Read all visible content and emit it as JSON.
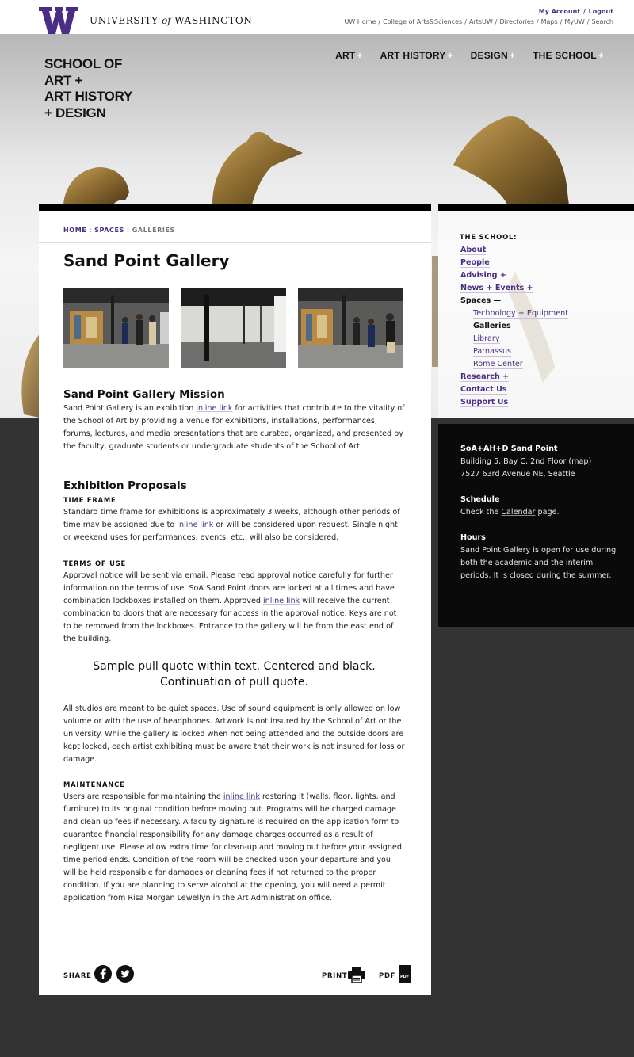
{
  "header": {
    "wordmark_left": "UNIVERSITY",
    "wordmark_of": "of",
    "wordmark_right": "WASHINGTON",
    "account": "My Account",
    "account_sep": "/",
    "logout": "Logout",
    "utility_links": [
      "UW Home",
      "College of Arts&Sciences",
      "ArtsUW",
      "Directories",
      "Maps",
      "MyUW",
      "Search"
    ]
  },
  "school_logo": [
    "SCHOOL OF",
    "ART +",
    "ART HISTORY",
    "+ DESIGN"
  ],
  "main_nav": [
    {
      "label": "ART",
      "icon": "plus-icon"
    },
    {
      "label": "ART HISTORY",
      "icon": "plus-icon"
    },
    {
      "label": "DESIGN",
      "icon": "plus-icon"
    },
    {
      "label": "THE SCHOOL",
      "icon": "plus-icon"
    }
  ],
  "breadcrumb": {
    "home": "HOME",
    "sep": ":",
    "spaces": "SPACES",
    "current": "GALLERIES"
  },
  "page": {
    "title": "Sand Point Gallery",
    "mission_heading": "Sand Point Gallery Mission",
    "mission_p": [
      "Sand Point Gallery is an exhibition ",
      "inline link",
      " for activities that contribute to the vitality of the School of Art by providing a venue for exhibitions, installations, performances, forums, lectures, and media presentations that are curated, organized, and presented by the faculty, graduate students or undergraduate students of the School of Art."
    ],
    "proposals_heading": "Exhibition Proposals",
    "time_frame_heading": "TIME FRAME",
    "time_frame_p": [
      "Standard time frame for exhibitions is approximately 3 weeks, although other periods of time may be assigned due to ",
      "inline link",
      " or will be considered upon request. Single night or weekend uses for performances, events, etc., will also be considered."
    ],
    "terms_heading": "TERMS OF USE",
    "terms_p": [
      "Approval notice will be sent via email. Please read approval notice carefully for further information on the terms of use. SoA Sand Point doors are locked at all times and have combination lockboxes installed on them. Approved ",
      "inline link",
      " will receive the current combination to doors that are necessary for access in the approval notice. Keys are not to be removed from the lockboxes. Entrance to the gallery will be from the east end of the building."
    ],
    "pull_quote": "Sample pull quote within text. Centered and black. Continuation of pull quote.",
    "studios_p": "All studios are meant to be quiet spaces. Use of sound equipment is only allowed on low volume or with the use of headphones. Artwork is not insured by the School of Art or the university. While the gallery is locked when not being attended and the outside doors are kept locked, each artist exhibiting must be aware that their work is not insured for loss or damage.",
    "maintenance_heading": "MAINTENANCE",
    "maintenance_p": [
      "Users are responsible for maintaining the ",
      "inline link",
      " restoring it (walls, floor, lights, and furniture) to its original condition before moving out. Programs will be charged damage and clean up fees if necessary. A faculty signature is required on the application form to guarantee financial responsibility for any damage charges occurred as a result of negligent use. Please allow extra time for clean-up and moving out before your assigned time period ends. Condition of the room will be checked upon your departure and you will be held responsible for damages or cleaning fees if not returned to the proper condition. If you are planning to serve alcohol at the opening, you will need a permit application from Risa Morgan Lewellyn in the Art Administration office."
    ]
  },
  "share": {
    "label": "SHARE",
    "print": "PRINT",
    "pdf": "PDF",
    "pdf_icon_text": "PDF"
  },
  "sidebar": {
    "heading": "THE SCHOOL:",
    "items": [
      {
        "label": "About",
        "level": 0
      },
      {
        "label": "People",
        "level": 0
      },
      {
        "label": "Advising +",
        "level": 0
      },
      {
        "label": "News + Events +",
        "level": 0
      },
      {
        "label": "Spaces —",
        "level": 0
      },
      {
        "label": "Technology + Equipment",
        "level": 1
      },
      {
        "label": "Galleries",
        "level": 1
      },
      {
        "label": "Library",
        "level": 1
      },
      {
        "label": "Parnassus",
        "level": 1
      },
      {
        "label": "Rome Center",
        "level": 1
      },
      {
        "label": "Research +",
        "level": 0
      },
      {
        "label": "Contact Us",
        "level": 0
      },
      {
        "label": "Support Us",
        "level": 0
      }
    ]
  },
  "info": {
    "location_heading": "SoA+AH+D Sand Point",
    "location_line1": "Building 5, Bay C, 2nd Floor (map)",
    "location_line2": "7527 63rd Avenue NE, Seattle",
    "schedule_heading": "Schedule",
    "schedule_pre": "Check the ",
    "schedule_link": "Calendar",
    "schedule_post": " page.",
    "hours_heading": "Hours",
    "hours_text": "Sand Point Gallery is open for use during both the academic and the interim periods. It is closed during the summer."
  },
  "colors": {
    "brand_purple": "#4b2e83",
    "dark_bg": "#333333",
    "info_bg": "#0a0a0a"
  }
}
